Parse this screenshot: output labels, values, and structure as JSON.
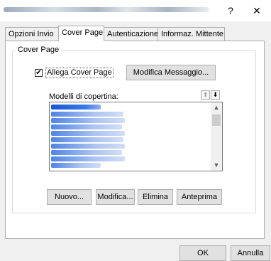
{
  "window": {
    "help_label": "?",
    "close_label": "✕"
  },
  "tabs": [
    {
      "label": "Opzioni Invio"
    },
    {
      "label": "Cover Page"
    },
    {
      "label": "Autenticazione"
    },
    {
      "label": "Informaz. Mittente"
    }
  ],
  "cover_page": {
    "group_label": "Cover Page",
    "attach_checkbox": {
      "label": "Allega Cover Page",
      "checked": true,
      "mark": "✔"
    },
    "edit_message_button": "Modifica Messaggio...",
    "templates_label": "Modelli di copertina:",
    "move_up_icon": "arrow-up-icon",
    "move_down_icon": "arrow-down-icon",
    "move_up_glyph": "⬆",
    "move_down_glyph": "⬇",
    "scroll_up_glyph": "▲",
    "scroll_down_glyph": "▼",
    "buttons": {
      "new": "Nuovo...",
      "edit": "Modifica...",
      "delete": "Elimina",
      "preview": "Anteprima"
    }
  },
  "dialog_buttons": {
    "ok": "OK",
    "cancel": "Annulla"
  }
}
